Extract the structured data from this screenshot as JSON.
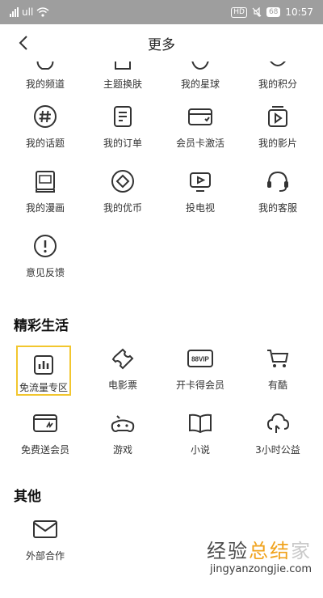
{
  "status": {
    "carrier": "ull",
    "badge_hd": "HD",
    "battery": "68",
    "time": "10:57"
  },
  "header": {
    "title": "更多"
  },
  "top_row": [
    "我的频道",
    "主题换肤",
    "我的星球",
    "我的积分"
  ],
  "grid1": [
    {
      "label": "我的话题",
      "icon": "hashtag-icon"
    },
    {
      "label": "我的订单",
      "icon": "order-list-icon"
    },
    {
      "label": "会员卡激活",
      "icon": "card-icon"
    },
    {
      "label": "我的影片",
      "icon": "video-icon"
    },
    {
      "label": "我的漫画",
      "icon": "comic-icon"
    },
    {
      "label": "我的优币",
      "icon": "coin-icon"
    },
    {
      "label": "投电视",
      "icon": "tv-cast-icon"
    },
    {
      "label": "我的客服",
      "icon": "headset-icon"
    },
    {
      "label": "意见反馈",
      "icon": "feedback-icon"
    }
  ],
  "section_life": {
    "title": "精彩生活"
  },
  "grid2": [
    {
      "label": "免流量专区",
      "icon": "data-free-icon",
      "highlighted": true
    },
    {
      "label": "电影票",
      "icon": "ticket-icon"
    },
    {
      "label": "开卡得会员",
      "icon": "vip-card-icon",
      "badge": "88VIP"
    },
    {
      "label": "有酷",
      "icon": "cart-icon"
    },
    {
      "label": "免费送会员",
      "icon": "gift-card-icon"
    },
    {
      "label": "游戏",
      "icon": "gamepad-icon"
    },
    {
      "label": "小说",
      "icon": "book-icon"
    },
    {
      "label": "3小时公益",
      "icon": "charity-icon"
    }
  ],
  "section_other": {
    "title": "其他"
  },
  "grid3": [
    {
      "label": "外部合作",
      "icon": "envelope-icon"
    }
  ],
  "watermark": {
    "logo_a": "经验",
    "logo_b": "总结",
    "logo_c": "家",
    "url": "jingyanzongjie.com"
  },
  "colors": {
    "statusbar": "#9e9e9e",
    "highlight": "#f2c62e",
    "icon": "#333333"
  }
}
